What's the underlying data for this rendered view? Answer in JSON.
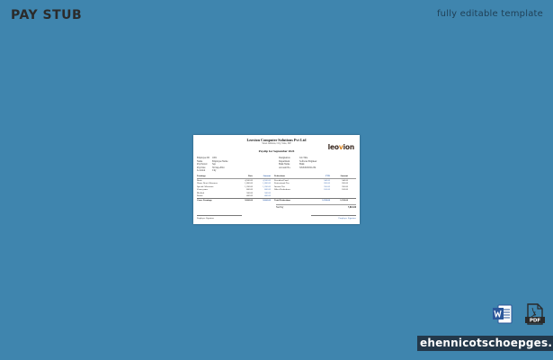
{
  "header": {
    "title": "PAY STUB",
    "subtitle": "fully editable template"
  },
  "document": {
    "company": "Leovion Computer Solutions Pvt Ltd",
    "address": "Street Address, City, State, ZIP",
    "period": "Payslip for September 2024",
    "logo_left": "leo",
    "logo_mid": "v",
    "logo_right": "ion",
    "info_left": [
      {
        "k": "Employee ID",
        "v": "1001"
      },
      {
        "k": "Name",
        "v": "Employee Name"
      },
      {
        "k": "Pay Period",
        "v": "Sep"
      },
      {
        "k": "Pay Date",
        "v": "30-Sep-2024"
      },
      {
        "k": "Location",
        "v": "City"
      }
    ],
    "info_right": [
      {
        "k": "Designation",
        "v": "Job Title"
      },
      {
        "k": "Department",
        "v": "Software Engineer"
      },
      {
        "k": "Bank Name",
        "v": "Bank"
      },
      {
        "k": "Account No.",
        "v": "XXXXXXX1234"
      }
    ],
    "table": {
      "headers": [
        "Earnings",
        "Rate",
        "Amount",
        "Deductions",
        "YTD",
        "Amount"
      ],
      "rows": [
        [
          "Basic",
          "4,500.00",
          "4,500.00",
          "Provident Fund",
          "540.00",
          "540.00"
        ],
        [
          "House Rent Allowance",
          "1,800.00",
          "1,800.00",
          "Professional Tax",
          "200.00",
          "200.00"
        ],
        [
          "Special Allowance",
          "1,200.00",
          "1,200.00",
          "Income Tax",
          "350.00",
          "350.00"
        ],
        [
          "Conveyance",
          "600.00",
          "600.00",
          "Other Deductions",
          "100.00",
          "100.00"
        ],
        [
          "Medical",
          "500.00",
          "500.00",
          "",
          "",
          ""
        ],
        [
          "Bonus",
          "400.00",
          "400.00",
          "",
          "",
          ""
        ]
      ],
      "total": [
        "Gross Earnings",
        "9,000.00",
        "9,000.00",
        "Total Deductions",
        "1,190.00",
        "1,190.00"
      ]
    },
    "net_pay_label": "Net Pay",
    "net_pay_value": "7,810.00",
    "sig_left": "Employer Signature",
    "sig_right": "Employee Signature"
  },
  "icons": {
    "word": "word-file-icon",
    "pdf": "pdf-file-icon"
  },
  "watermark": "ehennicotschoepges.lu",
  "colors": {
    "background": "#3f85ae",
    "word_blue": "#2b579a",
    "pdf_dark": "#2a2a2a",
    "watermark_bg": "#23384a"
  }
}
